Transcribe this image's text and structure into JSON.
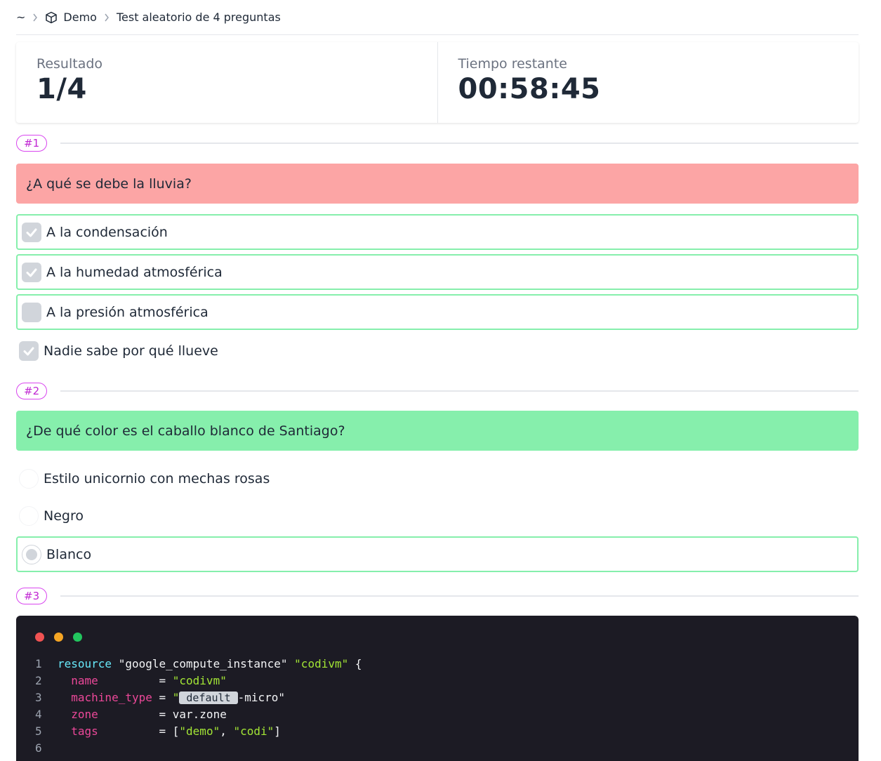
{
  "breadcrumb": {
    "home": "~",
    "project": "Demo",
    "page": "Test aleatorio de 4 preguntas"
  },
  "stats": {
    "result_label": "Resultado",
    "result_value": "1/4",
    "time_label": "Tiempo restante",
    "time_value": "00:58:45"
  },
  "q1": {
    "number": "#1",
    "title": "¿A qué se debe la lluvia?",
    "status": "wrong",
    "options": [
      {
        "label": "A la condensación",
        "checked": true
      },
      {
        "label": "A la humedad atmosférica",
        "checked": true
      },
      {
        "label": "A la presión atmosférica",
        "checked": false
      },
      {
        "label": "Nadie sabe por qué llueve",
        "checked": true
      }
    ]
  },
  "q2": {
    "number": "#2",
    "title": "¿De qué color es el caballo blanco de Santiago?",
    "status": "correct",
    "options": [
      {
        "label": "Estilo unicornio con mechas rosas",
        "selected": false
      },
      {
        "label": "Negro",
        "selected": false
      },
      {
        "label": "Blanco",
        "selected": true
      }
    ]
  },
  "q3": {
    "number": "#3",
    "code": {
      "line_numbers": [
        "1",
        "2",
        "3",
        "4",
        "5",
        "6"
      ],
      "line1": {
        "kw": "resource",
        "a": "\"google_compute_instance\"",
        "b": "\"codivm\"",
        "brace": "{"
      },
      "line2": {
        "key": "name",
        "pad": "         = ",
        "val": "\"codivm\""
      },
      "line3": {
        "key": "machine_type",
        "pad": " = ",
        "q1": "\"",
        "pill": "default",
        "rest": "-micro\""
      },
      "line4": {
        "key": "zone",
        "pad": "         = ",
        "val": "var.zone"
      },
      "line5": {
        "key": "tags",
        "pad": "         = ",
        "open": "[",
        "v1": "\"demo\"",
        "comma": ", ",
        "v2": "\"codi\"",
        "close": "]"
      }
    },
    "window_dots": [
      "#f05252",
      "#f5a524",
      "#22c55e"
    ]
  },
  "colors": {
    "accent": "#c026d3",
    "wrong_bg": "#fca5a5",
    "correct_bg": "#86efac",
    "correct_border": "#86efac"
  }
}
